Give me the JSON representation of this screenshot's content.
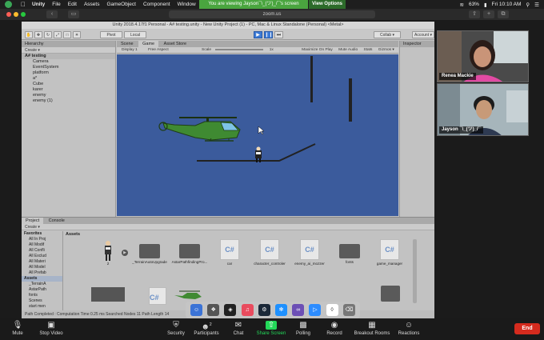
{
  "menubar": {
    "app_name": "Unity",
    "items": [
      "File",
      "Edit",
      "Assets",
      "GameObject",
      "Component",
      "Window"
    ],
    "banner_text": "You are viewing Jayson¯\\_(ツ)_/¯'s screen",
    "view_options": "View Options",
    "battery": "63%",
    "clock": "Fri 10:10 AM"
  },
  "browser": {
    "url": "zoom.us"
  },
  "unity": {
    "title": "Unity 2018.4.17f1 Personal - A# testing.unity - New Unity Project (1) - PC, Mac & Linux Standalone (Personal) <Metal>",
    "toolbar": {
      "pivot": "Pivot",
      "local": "Local",
      "collab": "Collab ▾",
      "account": "Account ▾"
    },
    "hierarchy": {
      "tab": "Hierarchy",
      "create": "Create ▾",
      "scene": "A# testing",
      "objects": [
        "Camera",
        "EventSystem",
        "platform",
        "a*",
        "Cube",
        "karer",
        "enemy",
        "enemy (1)"
      ]
    },
    "game": {
      "tabs": [
        "Scene",
        "Game",
        "Asset Store"
      ],
      "active_tab": "Game",
      "display": "Display 1",
      "aspect": "Free Aspect",
      "scale_label": "Scale",
      "scale_value": "1x",
      "options": [
        "Maximize On Play",
        "Mute Audio",
        "Stats",
        "Gizmos ▾"
      ]
    },
    "inspector_tab": "Inspector",
    "project": {
      "tabs": [
        "Project",
        "Console"
      ],
      "create": "Create ▾",
      "tree": [
        "Favorites",
        "All In Proj",
        "All Modif",
        "All Confli",
        "All Exclud",
        "All Materi",
        "All Model",
        "All Prefab",
        "Assets",
        "_TerrainA",
        "AstarPath",
        "fonts",
        "Scenes",
        "start men"
      ],
      "assets_label": "Assets",
      "items": [
        {
          "label": "_TerrainAutoUpgrade",
          "kind": "folder"
        },
        {
          "label": "AstarPathfindingPro...",
          "kind": "folder"
        },
        {
          "label": "car",
          "kind": "cs"
        },
        {
          "label": "character_controler",
          "kind": "cs"
        },
        {
          "label": "enemy_ai_mozzer",
          "kind": "cs"
        },
        {
          "label": "fonts",
          "kind": "folder"
        },
        {
          "label": "game_manager",
          "kind": "cs"
        }
      ],
      "first_item_label": "2"
    },
    "status": "Path Completed : Computation Time 0.25 ms Searched Nodes 11 Path Length 14"
  },
  "participants": [
    {
      "name": "Renea Mackie"
    },
    {
      "name": "Jayson ¯\\_(ツ)_/¯"
    }
  ],
  "zoom_bar": {
    "mute": "Mute",
    "stop_video": "Stop Video",
    "security": "Security",
    "participants": "Participants",
    "participants_count": "2",
    "chat": "Chat",
    "share_screen": "Share Screen",
    "polling": "Polling",
    "record": "Record",
    "breakout": "Breakout Rooms",
    "reactions": "Reactions",
    "end": "End"
  },
  "colors": {
    "game_bg": "#3b5b9c",
    "share_green": "#23d959",
    "end_red": "#d52b1e",
    "banner_green": "#4aa53f"
  }
}
